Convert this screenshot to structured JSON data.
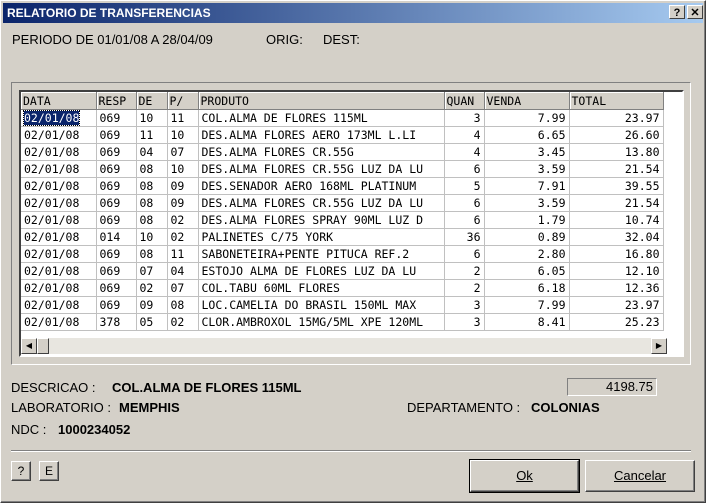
{
  "window": {
    "title": "RELATORIO DE TRANSFERENCIAS",
    "help_label": "?",
    "close_label": "✕"
  },
  "header": {
    "period": "PERIODO DE 01/01/08 A 28/04/09",
    "orig": "ORIG:",
    "dest": "DEST:"
  },
  "table": {
    "columns": [
      "DATA",
      "RESP",
      "DE",
      "P/",
      "PRODUTO",
      "QUAN",
      "VENDA",
      "TOTAL"
    ],
    "rows": [
      [
        "02/01/08",
        "069",
        "10",
        "11",
        "COL.ALMA DE FLORES 115ML",
        "3",
        "7.99",
        "23.97"
      ],
      [
        "02/01/08",
        "069",
        "11",
        "10",
        "DES.ALMA FLORES AERO 173ML L.LI",
        "4",
        "6.65",
        "26.60"
      ],
      [
        "02/01/08",
        "069",
        "04",
        "07",
        "DES.ALMA FLORES CR.55G",
        "4",
        "3.45",
        "13.80"
      ],
      [
        "02/01/08",
        "069",
        "08",
        "10",
        "DES.ALMA FLORES CR.55G LUZ DA LU",
        "6",
        "3.59",
        "21.54"
      ],
      [
        "02/01/08",
        "069",
        "08",
        "09",
        "DES.SENADOR AERO 168ML PLATINUM",
        "5",
        "7.91",
        "39.55"
      ],
      [
        "02/01/08",
        "069",
        "08",
        "09",
        "DES.ALMA FLORES CR.55G LUZ DA LU",
        "6",
        "3.59",
        "21.54"
      ],
      [
        "02/01/08",
        "069",
        "08",
        "02",
        "DES.ALMA FLORES SPRAY 90ML LUZ D",
        "6",
        "1.79",
        "10.74"
      ],
      [
        "02/01/08",
        "014",
        "10",
        "02",
        "PALINETES C/75 YORK",
        "36",
        "0.89",
        "32.04"
      ],
      [
        "02/01/08",
        "069",
        "08",
        "11",
        "SABONETEIRA+PENTE PITUCA REF.2",
        "6",
        "2.80",
        "16.80"
      ],
      [
        "02/01/08",
        "069",
        "07",
        "04",
        "ESTOJO ALMA DE FLORES LUZ DA LU",
        "2",
        "6.05",
        "12.10"
      ],
      [
        "02/01/08",
        "069",
        "02",
        "07",
        "COL.TABU 60ML FLORES",
        "2",
        "6.18",
        "12.36"
      ],
      [
        "02/01/08",
        "069",
        "09",
        "08",
        "LOC.CAMELIA DO BRASIL 150ML MAX",
        "3",
        "7.99",
        "23.97"
      ],
      [
        "02/01/08",
        "378",
        "05",
        "02",
        "CLOR.AMBROXOL 15MG/5ML XPE 120ML",
        "3",
        "8.41",
        "25.23"
      ]
    ]
  },
  "details": {
    "descricao_label": "DESCRICAO :",
    "descricao_value": "COL.ALMA DE FLORES 115ML",
    "total_value": "4198.75",
    "laboratorio_label": "LABORATORIO :",
    "laboratorio_value": "MEMPHIS",
    "departamento_label": "DEPARTAMENTO :",
    "departamento_value": "COLONIAS",
    "ndc_label": "NDC :",
    "ndc_value": "1000234052"
  },
  "buttons": {
    "help": "?",
    "e": "E",
    "ok": "Ok",
    "cancel": "Cancelar"
  },
  "colors": {
    "titlebar": "#0a246a",
    "face": "#d4d0c8",
    "selection": "#0a246a"
  }
}
